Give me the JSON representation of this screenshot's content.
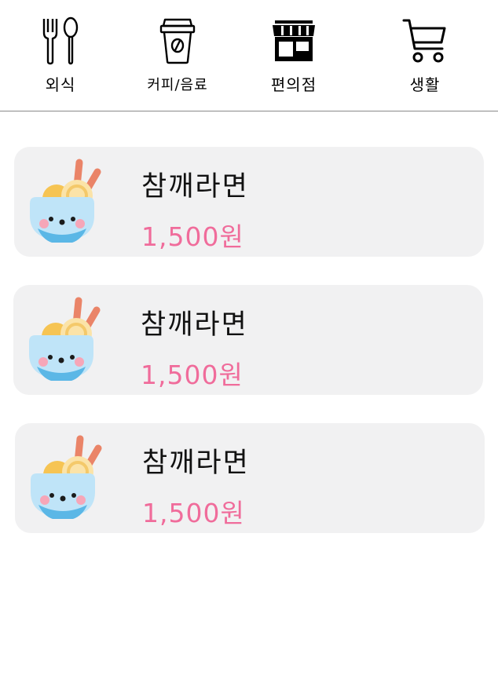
{
  "nav": {
    "items": [
      {
        "label": "외식",
        "icon": "fork-spoon-icon"
      },
      {
        "label": "커피/음료",
        "icon": "coffee-cup-icon"
      },
      {
        "label": "편의점",
        "icon": "store-icon"
      },
      {
        "label": "생활",
        "icon": "shopping-cart-icon"
      }
    ]
  },
  "products": [
    {
      "name": "참깨라면",
      "price": "1,500원",
      "icon": "ramen-bowl-icon"
    },
    {
      "name": "참깨라면",
      "price": "1,500원",
      "icon": "ramen-bowl-icon"
    },
    {
      "name": "참깨라면",
      "price": "1,500원",
      "icon": "ramen-bowl-icon"
    }
  ],
  "colors": {
    "price": "#f06c9b",
    "card_bg": "#f1f1f2",
    "divider": "#8a8a8a"
  }
}
